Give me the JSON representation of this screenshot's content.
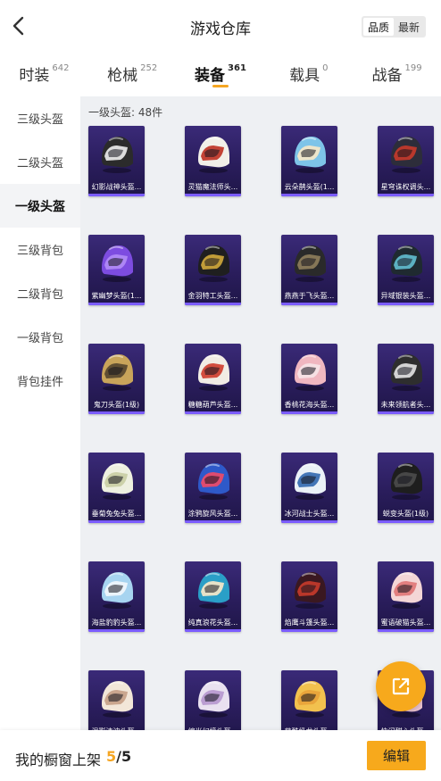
{
  "header": {
    "title": "游戏仓库",
    "sort_options": [
      "品质",
      "最新"
    ],
    "sort_selected": "品质"
  },
  "tabs": [
    {
      "label": "时装",
      "count": "642"
    },
    {
      "label": "枪械",
      "count": "252"
    },
    {
      "label": "装备",
      "count": "361",
      "active": true
    },
    {
      "label": "载具",
      "count": "0"
    },
    {
      "label": "战备",
      "count": "199"
    }
  ],
  "sidebar": {
    "items": [
      "三级头盔",
      "二级头盔",
      "一级头盔",
      "三级背包",
      "二级背包",
      "一级背包",
      "背包挂件"
    ],
    "active": "一级头盔"
  },
  "content": {
    "section_label": "一级头盔: 48件",
    "items": [
      {
        "name": "幻影战神头盔...",
        "colors": [
          "#2b2b2b",
          "#e5e5e5"
        ]
      },
      {
        "name": "灵猫魔法师头...",
        "colors": [
          "#f1efe8",
          "#c0392b"
        ]
      },
      {
        "name": "云朵鹊头盔(1...",
        "colors": [
          "#7ec4e8",
          "#f3e7c8"
        ]
      },
      {
        "name": "星穹诛权调头...",
        "colors": [
          "#2d2d3a",
          "#c0392b"
        ]
      },
      {
        "name": "紫幽梦头盔(1...",
        "colors": [
          "#7d4ce0",
          "#b089f5"
        ]
      },
      {
        "name": "金羽特工头盔...",
        "colors": [
          "#1f1f1f",
          "#c9a33a"
        ]
      },
      {
        "name": "燕燕于飞头盔...",
        "colors": [
          "#2a2a2a",
          "#8a7a5a"
        ]
      },
      {
        "name": "异域银装头盔...",
        "colors": [
          "#1f2a30",
          "#5fb7c9"
        ]
      },
      {
        "name": "鬼刀头盔(1级)",
        "colors": [
          "#c8a45a",
          "#5a4a30"
        ]
      },
      {
        "name": "糖糖葫芦头盔...",
        "colors": [
          "#f1ece4",
          "#d04535"
        ]
      },
      {
        "name": "香桃花海头盔...",
        "colors": [
          "#f0b7c0",
          "#f5e3e6"
        ]
      },
      {
        "name": "未来领航者头...",
        "colors": [
          "#2e2e2e",
          "#dcdcdc"
        ]
      },
      {
        "name": "垂菊兔兔头盔...",
        "colors": [
          "#eef0e0",
          "#c9cfa5"
        ]
      },
      {
        "name": "涂鸦旋风头盔...",
        "colors": [
          "#2e59c9",
          "#e84b6a"
        ]
      },
      {
        "name": "冰河战士头盔...",
        "colors": [
          "#eaf1f7",
          "#3a6fb3"
        ]
      },
      {
        "name": "蜕变头盔(1级)",
        "colors": [
          "#1e1e1e",
          "#4a4a4a"
        ]
      },
      {
        "name": "海盐豹豹头盔...",
        "colors": [
          "#a7d4f0",
          "#eef6fb"
        ]
      },
      {
        "name": "纯真浪花头盔...",
        "colors": [
          "#2a9fc7",
          "#f0e6c8"
        ]
      },
      {
        "name": "焰鹰斗篷头盔...",
        "colors": [
          "#3a1820",
          "#c0392b"
        ]
      },
      {
        "name": "蜜语破猫头盔...",
        "colors": [
          "#f4d6d6",
          "#e07a7a"
        ]
      },
      {
        "name": "温影清波头盔...",
        "colors": [
          "#f2e6d8",
          "#c7a28a"
        ]
      },
      {
        "name": "缤光幻境头盔...",
        "colors": [
          "#e9e1f0",
          "#b89ad0"
        ]
      },
      {
        "name": "萌酷奶龙头盔...",
        "colors": [
          "#f2c14e",
          "#e8a33a"
        ]
      },
      {
        "name": "快闪甜心头盔...",
        "colors": [
          "#f3c9d6",
          "#ffffff"
        ]
      }
    ]
  },
  "fab": {
    "icon": "share-icon"
  },
  "bottom": {
    "showcase_label": "我的橱窗上架",
    "showcase_count": "5",
    "showcase_sep": "/",
    "showcase_total": "5",
    "edit_label": "编辑"
  },
  "colors": {
    "accent": "#f7a91c",
    "card_bg": "#2a1d5c",
    "content_bg": "#eef0f3"
  }
}
